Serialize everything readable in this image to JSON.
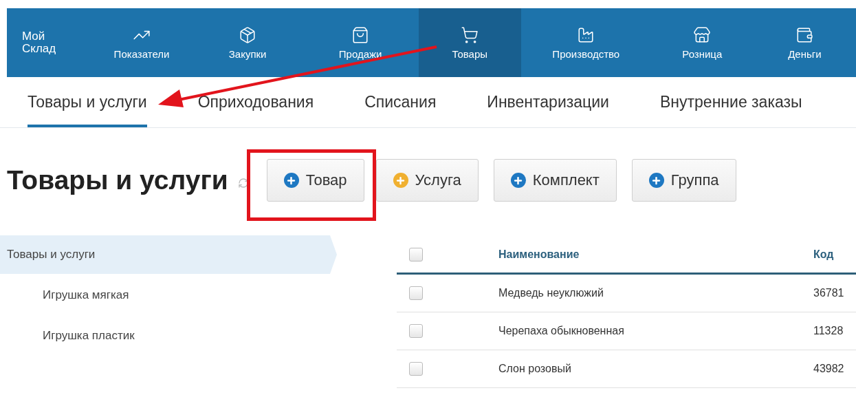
{
  "logo": {
    "line_1": "Мой",
    "line_2": "Склад"
  },
  "nav": [
    {
      "label": "Показатели",
      "selected": false
    },
    {
      "label": "Закупки",
      "selected": false
    },
    {
      "label": "Продажи",
      "selected": false
    },
    {
      "label": "Товары",
      "selected": true
    },
    {
      "label": "Производство",
      "selected": false
    },
    {
      "label": "Розница",
      "selected": false
    },
    {
      "label": "Деньги",
      "selected": false
    }
  ],
  "subtabs": [
    {
      "label": "Товары и услуги",
      "selected": true
    },
    {
      "label": "Оприходования",
      "selected": false
    },
    {
      "label": "Списания",
      "selected": false
    },
    {
      "label": "Инвентаризации",
      "selected": false
    },
    {
      "label": "Внутренние заказы",
      "selected": false
    }
  ],
  "page_title": "Товары и услуги",
  "buttons": [
    {
      "label": "Товар",
      "color": "#1e78c2",
      "highlighted": true
    },
    {
      "label": "Услуга",
      "color": "#f0b030",
      "highlighted": false
    },
    {
      "label": "Комплект",
      "color": "#1e78c2",
      "highlighted": false
    },
    {
      "label": "Группа",
      "color": "#1e78c2",
      "highlighted": false
    }
  ],
  "sidebar": {
    "items": [
      {
        "label": "Товары и услуги",
        "selected": true,
        "children": [
          {
            "label": "Игрушка мягкая",
            "selected": false
          },
          {
            "label": "Игрушка пластик",
            "selected": false
          }
        ]
      }
    ]
  },
  "table": {
    "all_checked": false,
    "columns": [
      "Наименование",
      "Код"
    ],
    "rows": [
      {
        "checked": false,
        "cells": [
          "Медведь неуклюжий",
          "36781"
        ]
      },
      {
        "checked": false,
        "cells": [
          "Черепаха обыкновенная",
          "11328"
        ]
      },
      {
        "checked": false,
        "cells": [
          "Слон розовый",
          "43982"
        ]
      }
    ]
  }
}
